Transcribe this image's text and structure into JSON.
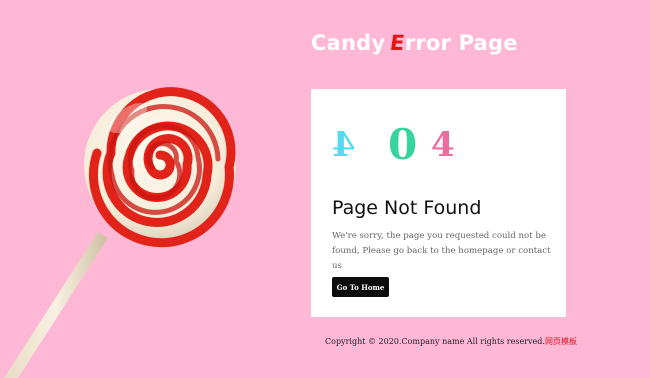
{
  "header": {
    "title_word_1": "Candy",
    "title_accent_letter": "E",
    "title_rest": "rror Page"
  },
  "error_card": {
    "code_digits": [
      "4",
      "0",
      "4"
    ],
    "title": "Page Not Found",
    "message": "We're sorry, the page you requested could not be found, Please go back to the homepage or contact us",
    "button_label": "Go To Home"
  },
  "footer": {
    "copyright": "Copyright © 2020.Company name All rights reserved.",
    "link_text": "网页模板"
  },
  "colors": {
    "background": "#ffb7d6",
    "title_accent": "#e31414",
    "digit_1": "#4fdcf0",
    "digit_2": "#39d39f",
    "digit_3": "#ee6d9f",
    "button_bg": "#0d0d0d",
    "footer_link": "#e0141f"
  },
  "icons": {
    "illustration": "lollipop-illustration"
  }
}
